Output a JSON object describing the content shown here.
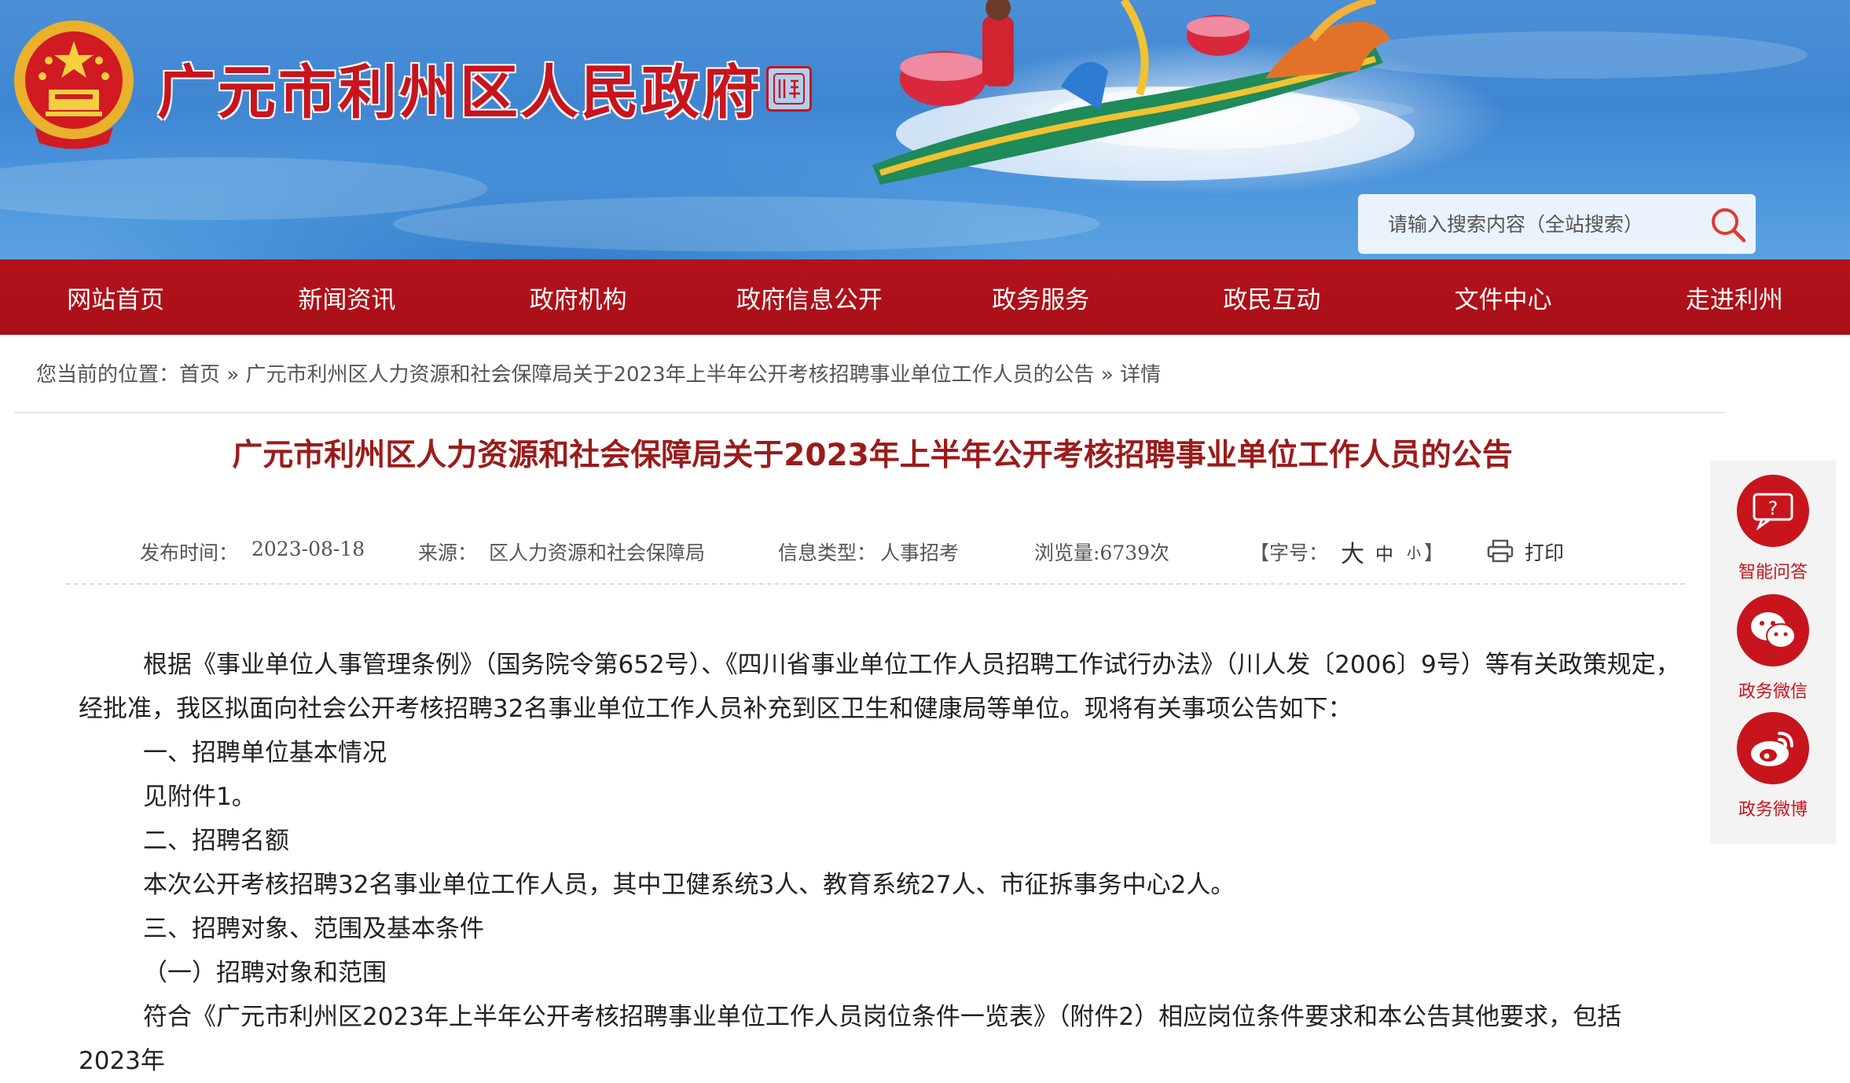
{
  "header": {
    "site_title": "广元市利州区人民政府",
    "seal_text": "利州 区 州",
    "search_placeholder": "请输入搜索内容（全站搜索）"
  },
  "nav": {
    "items": [
      "网站首页",
      "新闻资讯",
      "政府机构",
      "政府信息公开",
      "政务服务",
      "政民互动",
      "文件中心",
      "走进利州"
    ]
  },
  "breadcrumb": {
    "prefix": "您当前的位置：",
    "home": "首页",
    "sep1": " » ",
    "article": "广元市利州区人力资源和社会保障局关于2023年上半年公开考核招聘事业单位工作人员的公告",
    "sep2": " » ",
    "current": "详情"
  },
  "article": {
    "title": "广元市利州区人力资源和社会保障局关于2023年上半年公开考核招聘事业单位工作人员的公告",
    "meta": {
      "publish_label": "发布时间：",
      "publish_date": "2023-08-18",
      "source_label": "来源：",
      "source": "区人力资源和社会保障局",
      "type_label": "信息类型：",
      "type": "人事招考",
      "views": "浏览量:6739次",
      "fontsize_label": "【字号：",
      "size_large": "大",
      "size_medium": "中",
      "size_small": "小",
      "fontsize_end": "】",
      "print_label": "打印"
    },
    "paragraphs": [
      "根据《事业单位人事管理条例》（国务院令第652号）、《四川省事业单位工作人员招聘工作试行办法》（川人发〔2006〕9号）等有关政策规定，经批准，我区拟面向社会公开考核招聘32名事业单位工作人员补充到区卫生和健康局等单位。现将有关事项公告如下：",
      "一、招聘单位基本情况",
      "见附件1。",
      "二、招聘名额",
      "本次公开考核招聘32名事业单位工作人员，其中卫健系统3人、教育系统27人、市征拆事务中心2人。",
      "三、招聘对象、范围及基本条件",
      "（一）招聘对象和范围",
      "符合《广元市利州区2023年上半年公开考核招聘事业单位工作人员岗位条件一览表》（附件2）相应岗位条件要求和本公告其他要求，包括2023年"
    ]
  },
  "side_float": {
    "items": [
      {
        "label": "智能问答",
        "icon": "chat-question-icon"
      },
      {
        "label": "政务微信",
        "icon": "wechat-icon"
      },
      {
        "label": "政务微博",
        "icon": "weibo-icon"
      }
    ]
  },
  "colors": {
    "brand_red": "#b5121b",
    "title_red": "#9b1b1b",
    "banner_blue": "#4b8fd6"
  }
}
